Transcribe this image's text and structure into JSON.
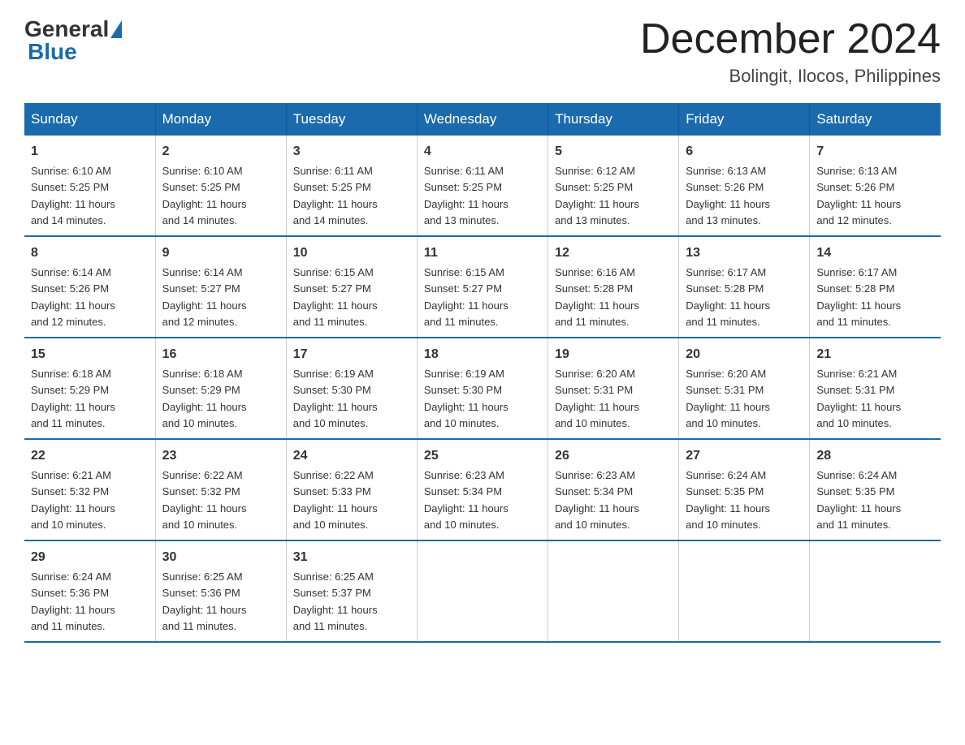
{
  "logo": {
    "general": "General",
    "blue": "Blue"
  },
  "header": {
    "month": "December 2024",
    "location": "Bolingit, Ilocos, Philippines"
  },
  "columns": [
    "Sunday",
    "Monday",
    "Tuesday",
    "Wednesday",
    "Thursday",
    "Friday",
    "Saturday"
  ],
  "weeks": [
    [
      {
        "day": "1",
        "sunrise": "6:10 AM",
        "sunset": "5:25 PM",
        "daylight": "11 hours and 14 minutes."
      },
      {
        "day": "2",
        "sunrise": "6:10 AM",
        "sunset": "5:25 PM",
        "daylight": "11 hours and 14 minutes."
      },
      {
        "day": "3",
        "sunrise": "6:11 AM",
        "sunset": "5:25 PM",
        "daylight": "11 hours and 14 minutes."
      },
      {
        "day": "4",
        "sunrise": "6:11 AM",
        "sunset": "5:25 PM",
        "daylight": "11 hours and 13 minutes."
      },
      {
        "day": "5",
        "sunrise": "6:12 AM",
        "sunset": "5:25 PM",
        "daylight": "11 hours and 13 minutes."
      },
      {
        "day": "6",
        "sunrise": "6:13 AM",
        "sunset": "5:26 PM",
        "daylight": "11 hours and 13 minutes."
      },
      {
        "day": "7",
        "sunrise": "6:13 AM",
        "sunset": "5:26 PM",
        "daylight": "11 hours and 12 minutes."
      }
    ],
    [
      {
        "day": "8",
        "sunrise": "6:14 AM",
        "sunset": "5:26 PM",
        "daylight": "11 hours and 12 minutes."
      },
      {
        "day": "9",
        "sunrise": "6:14 AM",
        "sunset": "5:27 PM",
        "daylight": "11 hours and 12 minutes."
      },
      {
        "day": "10",
        "sunrise": "6:15 AM",
        "sunset": "5:27 PM",
        "daylight": "11 hours and 11 minutes."
      },
      {
        "day": "11",
        "sunrise": "6:15 AM",
        "sunset": "5:27 PM",
        "daylight": "11 hours and 11 minutes."
      },
      {
        "day": "12",
        "sunrise": "6:16 AM",
        "sunset": "5:28 PM",
        "daylight": "11 hours and 11 minutes."
      },
      {
        "day": "13",
        "sunrise": "6:17 AM",
        "sunset": "5:28 PM",
        "daylight": "11 hours and 11 minutes."
      },
      {
        "day": "14",
        "sunrise": "6:17 AM",
        "sunset": "5:28 PM",
        "daylight": "11 hours and 11 minutes."
      }
    ],
    [
      {
        "day": "15",
        "sunrise": "6:18 AM",
        "sunset": "5:29 PM",
        "daylight": "11 hours and 11 minutes."
      },
      {
        "day": "16",
        "sunrise": "6:18 AM",
        "sunset": "5:29 PM",
        "daylight": "11 hours and 10 minutes."
      },
      {
        "day": "17",
        "sunrise": "6:19 AM",
        "sunset": "5:30 PM",
        "daylight": "11 hours and 10 minutes."
      },
      {
        "day": "18",
        "sunrise": "6:19 AM",
        "sunset": "5:30 PM",
        "daylight": "11 hours and 10 minutes."
      },
      {
        "day": "19",
        "sunrise": "6:20 AM",
        "sunset": "5:31 PM",
        "daylight": "11 hours and 10 minutes."
      },
      {
        "day": "20",
        "sunrise": "6:20 AM",
        "sunset": "5:31 PM",
        "daylight": "11 hours and 10 minutes."
      },
      {
        "day": "21",
        "sunrise": "6:21 AM",
        "sunset": "5:31 PM",
        "daylight": "11 hours and 10 minutes."
      }
    ],
    [
      {
        "day": "22",
        "sunrise": "6:21 AM",
        "sunset": "5:32 PM",
        "daylight": "11 hours and 10 minutes."
      },
      {
        "day": "23",
        "sunrise": "6:22 AM",
        "sunset": "5:32 PM",
        "daylight": "11 hours and 10 minutes."
      },
      {
        "day": "24",
        "sunrise": "6:22 AM",
        "sunset": "5:33 PM",
        "daylight": "11 hours and 10 minutes."
      },
      {
        "day": "25",
        "sunrise": "6:23 AM",
        "sunset": "5:34 PM",
        "daylight": "11 hours and 10 minutes."
      },
      {
        "day": "26",
        "sunrise": "6:23 AM",
        "sunset": "5:34 PM",
        "daylight": "11 hours and 10 minutes."
      },
      {
        "day": "27",
        "sunrise": "6:24 AM",
        "sunset": "5:35 PM",
        "daylight": "11 hours and 10 minutes."
      },
      {
        "day": "28",
        "sunrise": "6:24 AM",
        "sunset": "5:35 PM",
        "daylight": "11 hours and 11 minutes."
      }
    ],
    [
      {
        "day": "29",
        "sunrise": "6:24 AM",
        "sunset": "5:36 PM",
        "daylight": "11 hours and 11 minutes."
      },
      {
        "day": "30",
        "sunrise": "6:25 AM",
        "sunset": "5:36 PM",
        "daylight": "11 hours and 11 minutes."
      },
      {
        "day": "31",
        "sunrise": "6:25 AM",
        "sunset": "5:37 PM",
        "daylight": "11 hours and 11 minutes."
      },
      null,
      null,
      null,
      null
    ]
  ],
  "labels": {
    "sunrise": "Sunrise:",
    "sunset": "Sunset:",
    "daylight": "Daylight:"
  }
}
